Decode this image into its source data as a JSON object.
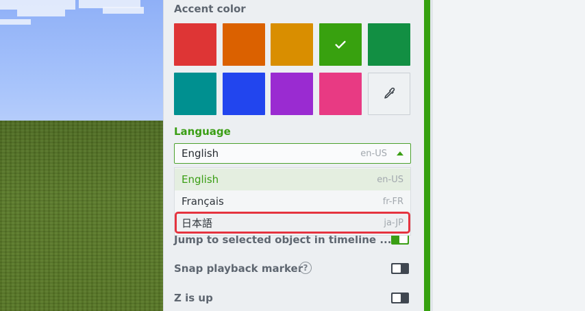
{
  "accent": {
    "label": "Accent color",
    "selected_index": 3,
    "colors": [
      "#de3535",
      "#db6100",
      "#d98e00",
      "#38a10f",
      "#128f43",
      "#009090",
      "#2245ee",
      "#9a2bd1",
      "#e83a83"
    ],
    "picker_icon": "eyedropper-icon",
    "check_icon": "checkmark-icon"
  },
  "language": {
    "label": "Language",
    "selected_label": "English",
    "selected_code": "en-US",
    "options": [
      {
        "label": "English",
        "code": "en-US"
      },
      {
        "label": "Français",
        "code": "fr-FR"
      },
      {
        "label": "日本語",
        "code": "ja-JP"
      }
    ]
  },
  "settings": {
    "jump_label": "Jump to selected object in timeline ...",
    "jump_on": true,
    "snap_label": "Snap playback marker",
    "snap_on": false,
    "help_glyph": "?",
    "zup_label": "Z is up",
    "zup_on": false
  }
}
